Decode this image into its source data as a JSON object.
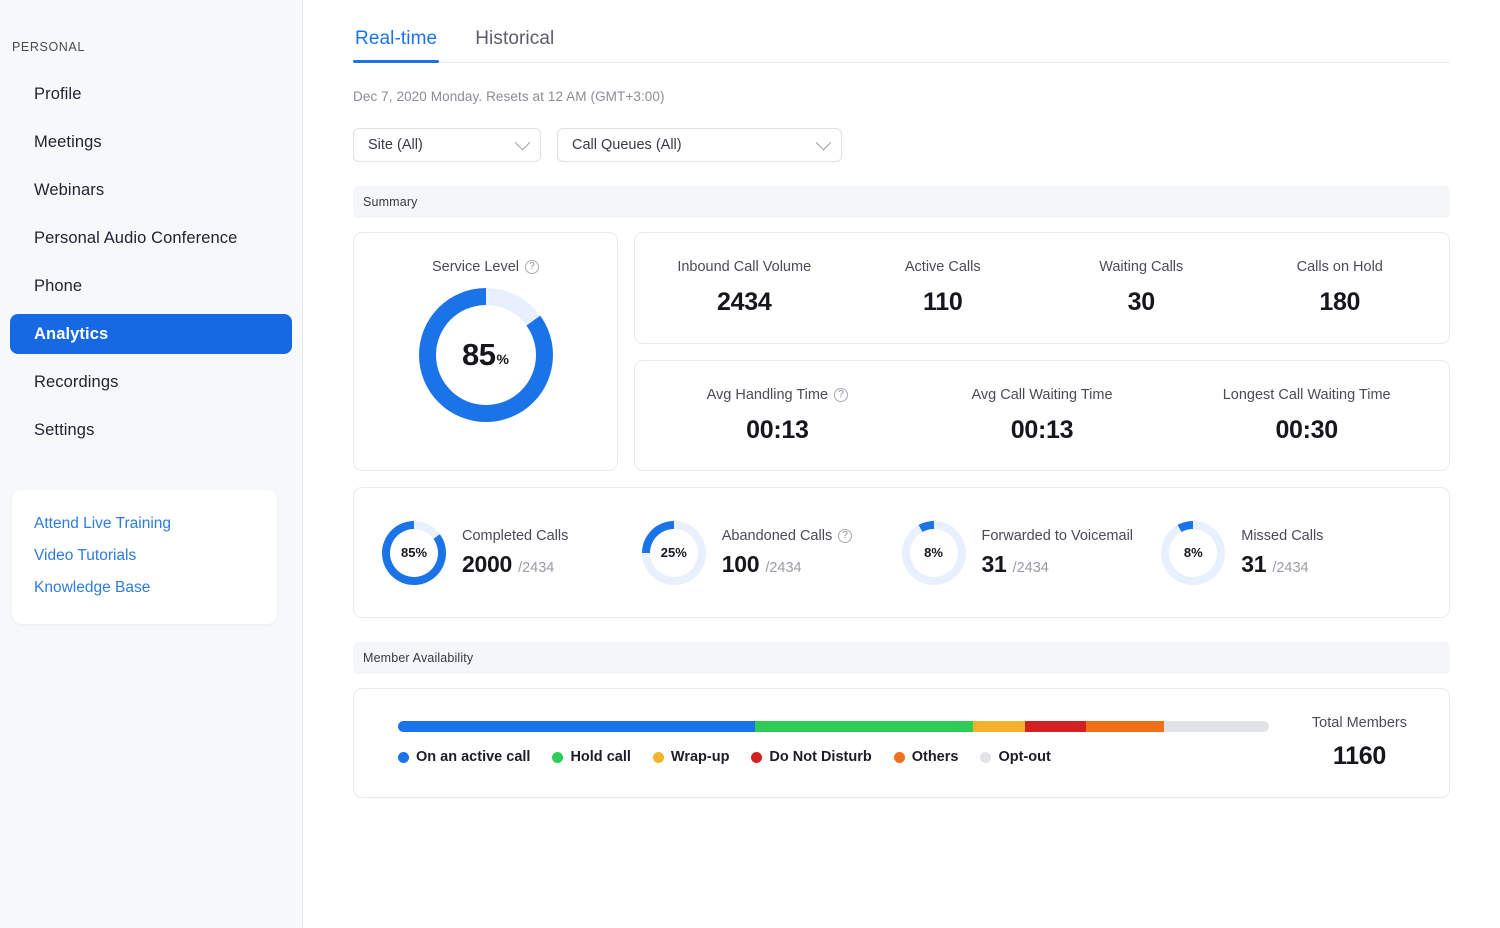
{
  "sidebar": {
    "section_label": "PERSONAL",
    "items": [
      {
        "label": "Profile",
        "active": false
      },
      {
        "label": "Meetings",
        "active": false
      },
      {
        "label": "Webinars",
        "active": false
      },
      {
        "label": "Personal Audio Conference",
        "active": false
      },
      {
        "label": "Phone",
        "active": false
      },
      {
        "label": "Analytics",
        "active": true
      },
      {
        "label": "Recordings",
        "active": false
      },
      {
        "label": "Settings",
        "active": false
      }
    ],
    "help_links": [
      "Attend Live Training",
      "Video Tutorials",
      "Knowledge Base"
    ]
  },
  "tabs": [
    {
      "label": "Real-time",
      "active": true
    },
    {
      "label": "Historical",
      "active": false
    }
  ],
  "date_note": "Dec 7, 2020 Monday. Resets at 12 AM (GMT+3:00)",
  "filters": [
    {
      "name": "site",
      "value": "Site (All)"
    },
    {
      "name": "call_queues",
      "value": "Call Queues (All)"
    }
  ],
  "sections": {
    "summary": "Summary",
    "member_availability": "Member Availability"
  },
  "service_level": {
    "title": "Service Level",
    "help": "?",
    "value": 85,
    "value_text": "85",
    "unit": "%"
  },
  "stats_row_1": [
    {
      "label": "Inbound Call Volume",
      "value": "2434",
      "help": false
    },
    {
      "label": "Active Calls",
      "value": "110",
      "help": false
    },
    {
      "label": "Waiting Calls",
      "value": "30",
      "help": false
    },
    {
      "label": "Calls on Hold",
      "value": "180",
      "help": false
    }
  ],
  "stats_row_2": [
    {
      "label": "Avg Handling Time",
      "value": "00:13",
      "help": true
    },
    {
      "label": "Avg Call Waiting Time",
      "value": "00:13",
      "help": false
    },
    {
      "label": "Longest Call Waiting Time",
      "value": "00:30",
      "help": false
    }
  ],
  "breakdown": [
    {
      "title": "Completed Calls",
      "percent": 85,
      "percent_text": "85%",
      "value": "2000",
      "denominator": "/2434",
      "help": false
    },
    {
      "title": "Abandoned Calls",
      "percent": 25,
      "percent_text": "25%",
      "value": "100",
      "denominator": "/2434",
      "help": true
    },
    {
      "title": "Forwarded to Voicemail",
      "percent": 8,
      "percent_text": "8%",
      "value": "31",
      "denominator": "/2434",
      "help": false
    },
    {
      "title": "Missed Calls",
      "percent": 8,
      "percent_text": "8%",
      "value": "31",
      "denominator": "/2434",
      "help": false
    }
  ],
  "member_availability": {
    "total_label": "Total Members",
    "total_value": "1160",
    "segments": [
      {
        "label": "On an active call",
        "color": "#1a73e8",
        "width_pct": 41.0
      },
      {
        "label": "Hold call",
        "color": "#2ecc57",
        "width_pct": 25.0
      },
      {
        "label": "Wrap-up",
        "color": "#f6b12c",
        "width_pct": 6.0
      },
      {
        "label": "Do Not Disturb",
        "color": "#d32121",
        "width_pct": 7.0
      },
      {
        "label": "Others",
        "color": "#f0701a",
        "width_pct": 9.0
      },
      {
        "label": "Opt-out",
        "color": "#e1e3e7",
        "width_pct": 12.0
      }
    ]
  },
  "colors": {
    "accent": "#1a74e8",
    "sidebar_active": "#1668e3",
    "donut_track": "#e8f0fd",
    "text_dark": "#16161d",
    "text_muted": "#4b4b57"
  },
  "chart_data": [
    {
      "type": "pie",
      "title": "Service Level",
      "labels": [
        "Service Level",
        "Remaining"
      ],
      "values": [
        85,
        15
      ],
      "unit": "%",
      "center_label": "85%",
      "colors": [
        "#1a74e8",
        "#e8f0fd"
      ],
      "direction": "counter-clockwise",
      "start_angle_deg": 90
    },
    {
      "type": "pie",
      "title": "Completed Calls",
      "labels": [
        "Completed Calls",
        "Remaining"
      ],
      "values": [
        85,
        15
      ],
      "unit": "%",
      "center_label": "85%",
      "numerator": 2000,
      "denominator": 2434,
      "colors": [
        "#1a74e8",
        "#e8f0fd"
      ],
      "direction": "counter-clockwise",
      "start_angle_deg": 90
    },
    {
      "type": "pie",
      "title": "Abandoned Calls",
      "labels": [
        "Abandoned Calls",
        "Remaining"
      ],
      "values": [
        25,
        75
      ],
      "unit": "%",
      "center_label": "25%",
      "numerator": 100,
      "denominator": 2434,
      "colors": [
        "#1a74e8",
        "#e8f0fd"
      ],
      "direction": "counter-clockwise",
      "start_angle_deg": 90
    },
    {
      "type": "pie",
      "title": "Forwarded to Voicemail",
      "labels": [
        "Forwarded to Voicemail",
        "Remaining"
      ],
      "values": [
        8,
        92
      ],
      "unit": "%",
      "center_label": "8%",
      "numerator": 31,
      "denominator": 2434,
      "colors": [
        "#1a74e8",
        "#e8f0fd"
      ],
      "direction": "counter-clockwise",
      "start_angle_deg": 90
    },
    {
      "type": "pie",
      "title": "Missed Calls",
      "labels": [
        "Missed Calls",
        "Remaining"
      ],
      "values": [
        8,
        92
      ],
      "unit": "%",
      "center_label": "8%",
      "numerator": 31,
      "denominator": 2434,
      "colors": [
        "#1a74e8",
        "#e8f0fd"
      ],
      "direction": "counter-clockwise",
      "start_angle_deg": 90
    },
    {
      "type": "bar",
      "title": "Member Availability",
      "orientation": "horizontal-stacked",
      "categories": [
        "On an active call",
        "Hold call",
        "Wrap-up",
        "Do Not Disturb",
        "Others",
        "Opt-out"
      ],
      "values": [
        41.0,
        25.0,
        6.0,
        7.0,
        9.0,
        12.0
      ],
      "unit": "%",
      "colors": [
        "#1a73e8",
        "#2ecc57",
        "#f6b12c",
        "#d32121",
        "#f0701a",
        "#e1e3e7"
      ],
      "total_members": 1160,
      "legend_position": "bottom"
    }
  ]
}
